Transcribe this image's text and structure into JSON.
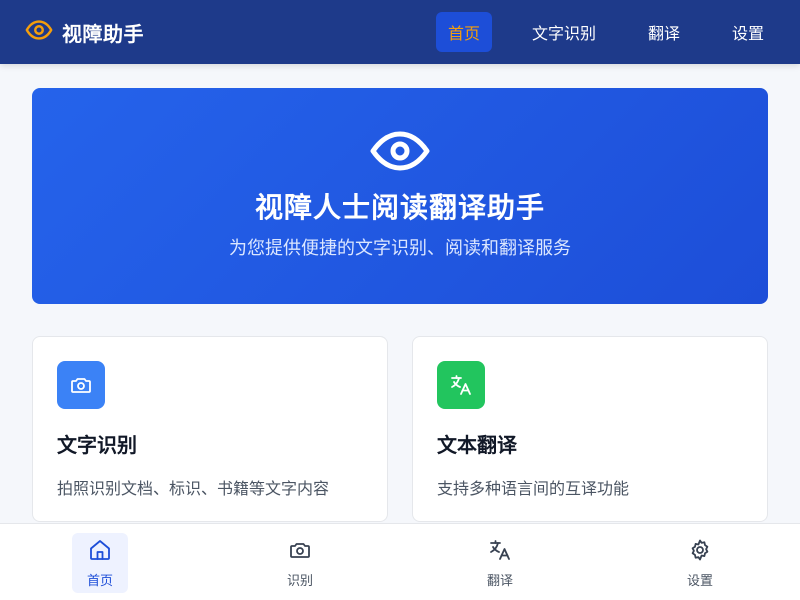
{
  "header": {
    "brand_name": "视障助手",
    "nav": [
      {
        "label": "首页",
        "active": true
      },
      {
        "label": "文字识别",
        "active": false
      },
      {
        "label": "翻译",
        "active": false
      },
      {
        "label": "设置",
        "active": false
      }
    ]
  },
  "hero": {
    "icon": "eye-icon",
    "title": "视障人士阅读翻译助手",
    "subtitle": "为您提供便捷的文字识别、阅读和翻译服务"
  },
  "cards": [
    {
      "icon": "camera-icon",
      "title": "文字识别",
      "description": "拍照识别文档、标识、书籍等文字内容",
      "color": "#3b82f6"
    },
    {
      "icon": "translate-icon",
      "title": "文本翻译",
      "description": "支持多种语言间的互译功能",
      "color": "#22c55e"
    }
  ],
  "tabbar": [
    {
      "icon": "home-icon",
      "label": "首页",
      "active": true
    },
    {
      "icon": "camera-icon",
      "label": "识别",
      "active": false
    },
    {
      "icon": "translate-icon",
      "label": "翻译",
      "active": false
    },
    {
      "icon": "gear-icon",
      "label": "设置",
      "active": false
    }
  ],
  "colors": {
    "header_bg": "#1e3a8a",
    "accent": "#f59e0b",
    "primary": "#2563eb",
    "green": "#22c55e"
  }
}
